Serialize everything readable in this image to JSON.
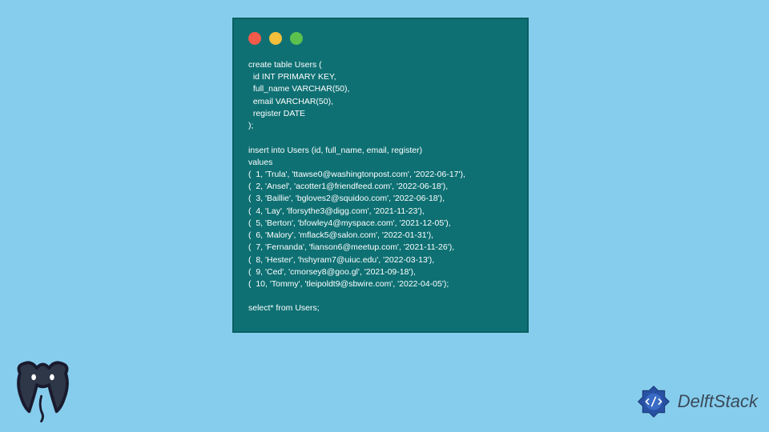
{
  "code": "create table Users (\n  id INT PRIMARY KEY,\n  full_name VARCHAR(50),\n  email VARCHAR(50),\n  register DATE\n);\n\ninsert into Users (id, full_name, email, register)\nvalues\n(  1, 'Trula', 'ttawse0@washingtonpost.com', '2022-06-17'),\n(  2, 'Ansel', 'acotter1@friendfeed.com', '2022-06-18'),\n(  3, 'Baillie', 'bgloves2@squidoo.com', '2022-06-18'),\n(  4, 'Lay', 'lforsythe3@digg.com', '2021-11-23'),\n(  5, 'Berton', 'bfowley4@myspace.com', '2021-12-05'),\n(  6, 'Malory', 'mflack5@salon.com', '2022-01-31'),\n(  7, 'Fernanda', 'fianson6@meetup.com', '2021-11-26'),\n(  8, 'Hester', 'hshyram7@uiuc.edu', '2022-03-13'),\n(  9, 'Ced', 'cmorsey8@goo.gl', '2021-09-18'),\n(  10, 'Tommy', 'tleipoldt9@sbwire.com', '2022-04-05');\n\nselect* from Users;",
  "brand": "DelftStack"
}
